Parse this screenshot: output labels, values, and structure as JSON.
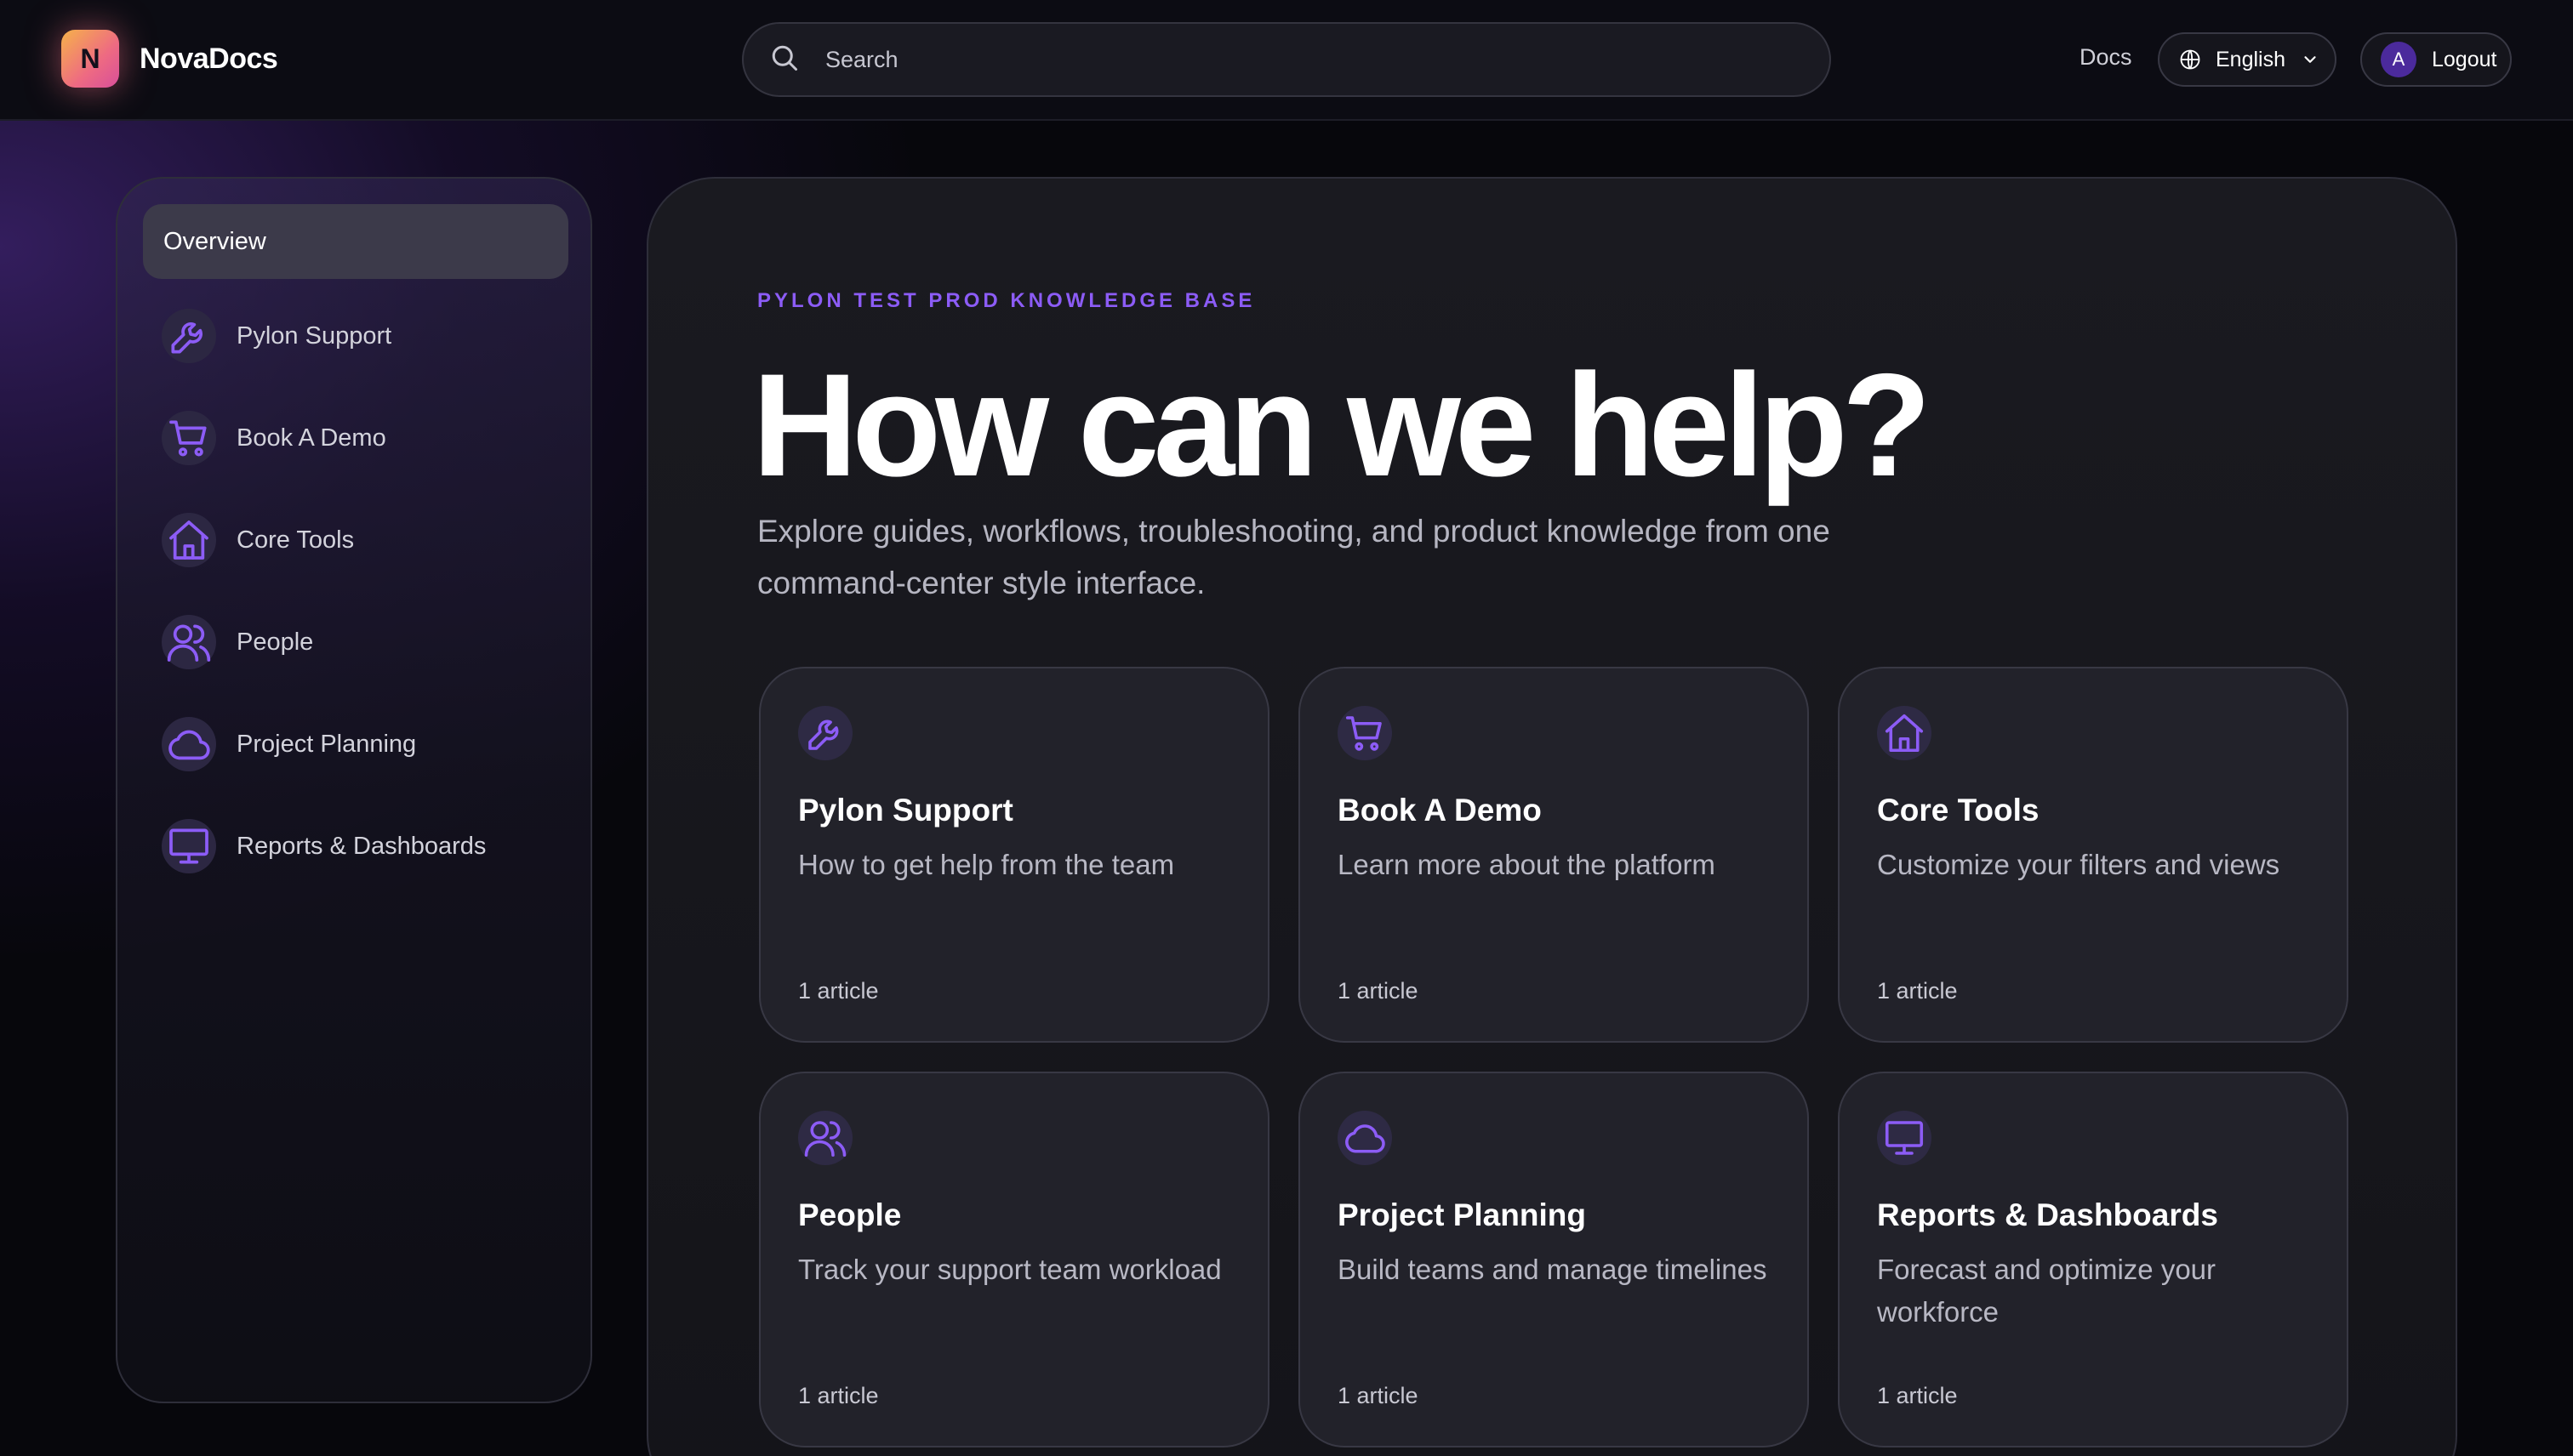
{
  "app": {
    "name": "NovaDocs",
    "logo_letter": "N"
  },
  "header": {
    "search_placeholder": "Search",
    "docs_label": "Docs",
    "language": "English",
    "avatar_letter": "A",
    "logout_label": "Logout"
  },
  "colors": {
    "accent": "#8c5cf6",
    "background": "#07070c",
    "panel": "#1a1a20"
  },
  "sidebar": {
    "overview_label": "Overview",
    "items": [
      {
        "label": "Pylon Support",
        "icon": "wrench-icon"
      },
      {
        "label": "Book A Demo",
        "icon": "cart-icon"
      },
      {
        "label": "Core Tools",
        "icon": "home-icon"
      },
      {
        "label": "People",
        "icon": "users-icon"
      },
      {
        "label": "Project Planning",
        "icon": "cloud-icon"
      },
      {
        "label": "Reports & Dashboards",
        "icon": "monitor-icon"
      }
    ]
  },
  "main": {
    "eyebrow": "PYLON TEST PROD KNOWLEDGE BASE",
    "title": "How can we help?",
    "subtitle": "Explore guides, workflows, troubleshooting, and product knowledge from one command-center style interface.",
    "cards": [
      {
        "title": "Pylon Support",
        "description": "How to get help from the team",
        "count": "1 article",
        "icon": "wrench-icon"
      },
      {
        "title": "Book A Demo",
        "description": "Learn more about the platform",
        "count": "1 article",
        "icon": "cart-icon"
      },
      {
        "title": "Core Tools",
        "description": "Customize your filters and views",
        "count": "1 article",
        "icon": "home-icon"
      },
      {
        "title": "People",
        "description": "Track your support team workload",
        "count": "1 article",
        "icon": "users-icon"
      },
      {
        "title": "Project Planning",
        "description": "Build teams and manage timelines",
        "count": "1 article",
        "icon": "cloud-icon"
      },
      {
        "title": "Reports & Dashboards",
        "description": "Forecast and optimize your workforce",
        "count": "1 article",
        "icon": "monitor-icon"
      }
    ]
  }
}
